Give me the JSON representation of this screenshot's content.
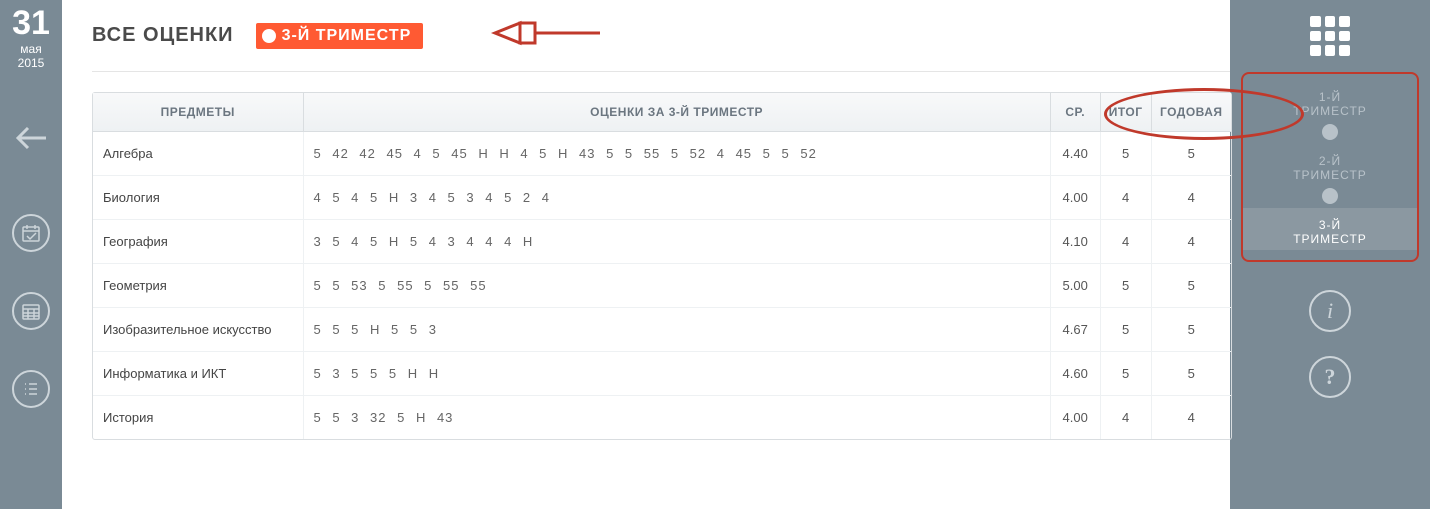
{
  "date": {
    "day": "31",
    "month": "мая",
    "year": "2015"
  },
  "header": {
    "title": "ВСЕ ОЦЕНКИ",
    "badge": "3-Й ТРИМЕСТР"
  },
  "columns": {
    "subject": "ПРЕДМЕТЫ",
    "grades": "ОЦЕНКИ ЗА 3-Й ТРИМЕСТР",
    "avg": "СР.",
    "final": "ИТОГ",
    "year": "ГОДОВАЯ"
  },
  "rows": [
    {
      "subject": "Алгебра",
      "grades": "5 42 42 45 4 5 45 Н Н 4 5 Н 43 5 5 55 5 52 4 45 5 5 52",
      "avg": "4.40",
      "final": "5",
      "year": "5"
    },
    {
      "subject": "Биология",
      "grades": "4 5 4 5 Н 3 4 5 3 4 5 2 4",
      "avg": "4.00",
      "final": "4",
      "year": "4"
    },
    {
      "subject": "География",
      "grades": "3 5 4 5 Н 5 4 3 4 4 4 Н",
      "avg": "4.10",
      "final": "4",
      "year": "4"
    },
    {
      "subject": "Геометрия",
      "grades": "5 5 53 5 55 5 55 55",
      "avg": "5.00",
      "final": "5",
      "year": "5"
    },
    {
      "subject": "Изобразительное искусство",
      "grades": "5 5 5 Н 5 5 3",
      "avg": "4.67",
      "final": "5",
      "year": "5"
    },
    {
      "subject": "Информатика и ИКТ",
      "grades": "5 3 5 5 5 Н Н",
      "avg": "4.60",
      "final": "5",
      "year": "5"
    },
    {
      "subject": "История",
      "grades": "5 5 3 32 5 Н 43",
      "avg": "4.00",
      "final": "4",
      "year": "4"
    }
  ],
  "trimesters": [
    {
      "line1": "1-Й",
      "line2": "ТРИМЕСТР",
      "active": false
    },
    {
      "line1": "2-Й",
      "line2": "ТРИМЕСТР",
      "active": false
    },
    {
      "line1": "3-Й",
      "line2": "ТРИМЕСТР",
      "active": true
    }
  ],
  "aux": {
    "info": "i",
    "help": "?"
  }
}
